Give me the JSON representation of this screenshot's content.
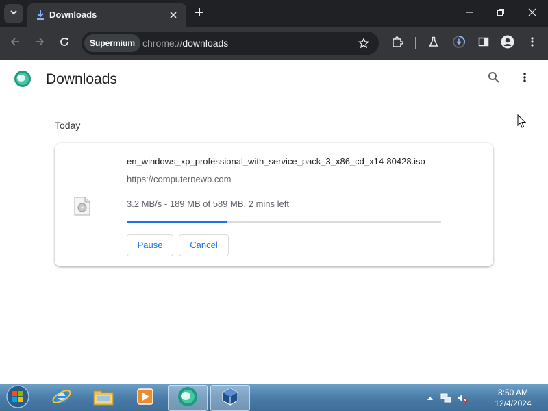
{
  "browser": {
    "tab": {
      "title": "Downloads"
    },
    "omnibox": {
      "chip": "Supermium",
      "url_scheme": "chrome://",
      "url_path": "downloads"
    }
  },
  "page": {
    "title": "Downloads",
    "date_group": "Today"
  },
  "download": {
    "file_name": "en_windows_xp_professional_with_service_pack_3_x86_cd_x14-80428.iso",
    "source": "https://computernewb.com",
    "status": "3.2 MB/s - 189 MB of 589 MB, 2 mins left",
    "progress_fraction": 0.32,
    "pause_label": "Pause",
    "cancel_label": "Cancel"
  },
  "taskbar": {
    "clock_time": "8:50 AM",
    "clock_date": "12/4/2024"
  },
  "colors": {
    "accent": "#1a73e8",
    "frame": "#202124",
    "toolbar": "#35363a"
  }
}
